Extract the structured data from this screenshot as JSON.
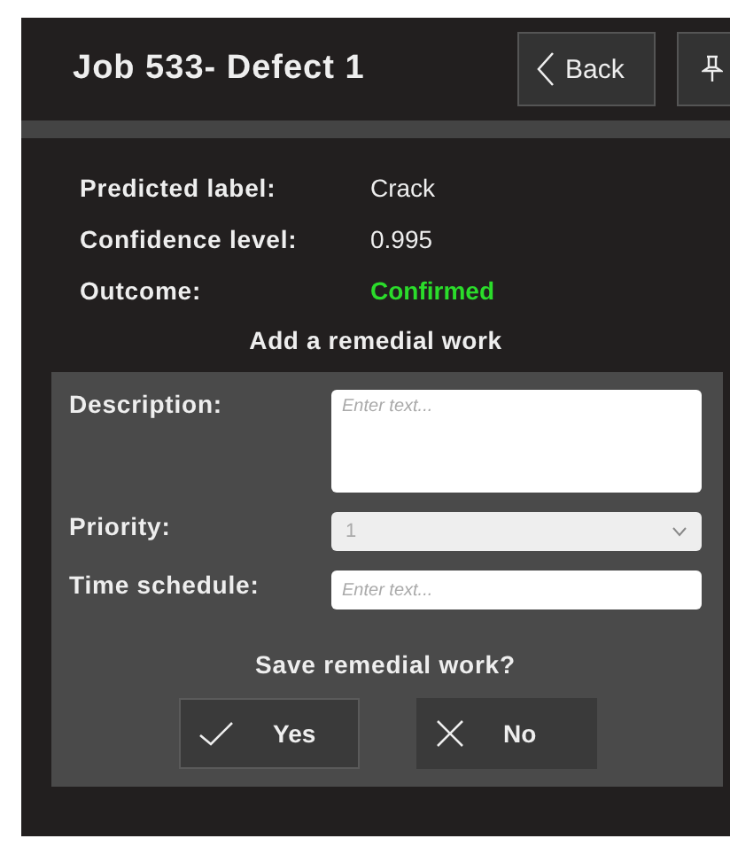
{
  "header": {
    "title": "Job 533-  Defect 1",
    "back_button": "Back"
  },
  "details": [
    {
      "label": "Predicted label:",
      "value": "Crack",
      "kind": "plain"
    },
    {
      "label": "Confidence level:",
      "value": "0.995",
      "kind": "plain"
    },
    {
      "label": "Outcome:",
      "value": "Confirmed",
      "kind": "success"
    }
  ],
  "section_title": "Add a remedial work",
  "form": {
    "description": {
      "label": "Description:",
      "placeholder": "Enter text..."
    },
    "priority": {
      "label": "Priority:",
      "value": "1"
    },
    "time_schedule": {
      "label": "Time schedule:",
      "placeholder": "Enter text..."
    }
  },
  "question": "Save remedial work?",
  "buttons": [
    {
      "label": "Yes",
      "kind": "confirm"
    },
    {
      "label": "No",
      "kind": "cancel"
    }
  ]
}
